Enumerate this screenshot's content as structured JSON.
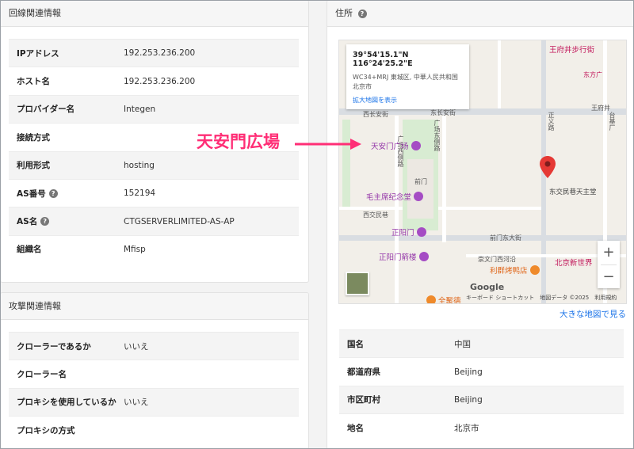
{
  "network": {
    "title": "回線関連情報",
    "rows": [
      {
        "key": "IPアドレス",
        "value": "192.253.236.200",
        "help": false
      },
      {
        "key": "ホスト名",
        "value": "192.253.236.200",
        "help": false
      },
      {
        "key": "プロバイダー名",
        "value": "Integen",
        "help": false
      },
      {
        "key": "接続方式",
        "value": "",
        "help": false
      },
      {
        "key": "利用形式",
        "value": "hosting",
        "help": false
      },
      {
        "key": "AS番号",
        "value": "152194",
        "help": true
      },
      {
        "key": "AS名",
        "value": "CTGSERVERLIMITED-AS-AP",
        "help": true
      },
      {
        "key": "組織名",
        "value": "Mfisp",
        "help": false
      }
    ]
  },
  "attack": {
    "title": "攻撃関連情報",
    "rows": [
      {
        "key": "クローラーであるか",
        "value": "いいえ"
      },
      {
        "key": "クローラー名",
        "value": ""
      },
      {
        "key": "プロキシを使用しているか",
        "value": "いいえ"
      },
      {
        "key": "プロキシの方式",
        "value": ""
      }
    ]
  },
  "address": {
    "title": "住所",
    "help_icon": "question-circle-icon",
    "bigmap_link": "大きな地図で見る",
    "rows": [
      {
        "key": "国名",
        "value": "中国"
      },
      {
        "key": "都道府県",
        "value": "Beijing"
      },
      {
        "key": "市区町村",
        "value": "Beijing"
      },
      {
        "key": "地名",
        "value": "北京市"
      }
    ]
  },
  "map": {
    "coords": "39°54'15.1\"N 116°24'25.2\"E",
    "plus_code_line1": "WC34+MRJ 東城区, 中華人民共和国",
    "plus_code_line2": "北京市",
    "enlarge_link": "拡大地図を表示",
    "google_logo": "Google",
    "footer": "キーボード ショートカット　地図データ ©2025　利用規約",
    "zoom_in": "+",
    "zoom_out": "−",
    "labels": {
      "xichang": "西长安街",
      "dongchang": "东长安街",
      "qianmen": "前门",
      "xijiaominxiang": "西交民巷",
      "qianmendong": "前门东大街",
      "chongwen": "崇文门西河沿",
      "dongjiaominxiang": "东交民巷天主堂",
      "wangfujing": "王府井步行街",
      "dongfang": "东方广",
      "wangfujing2": "王府井",
      "guangchang_e": "广场东侧路",
      "guangchang_w": "广场西侧路",
      "zhengyi": "正义路",
      "taijichang": "台基厂"
    },
    "pois": {
      "tiananmen": "天安门广场",
      "maozhuxi": "毛主席纪念堂",
      "zhengyangmen": "正阳门",
      "jianlou": "正阳门箭楼",
      "liqun": "利群烤鸭店",
      "newworld": "北京新世界",
      "quanjude": "全聚德"
    }
  },
  "annotation": {
    "text": "天安門広場",
    "color": "#ff2e76"
  }
}
